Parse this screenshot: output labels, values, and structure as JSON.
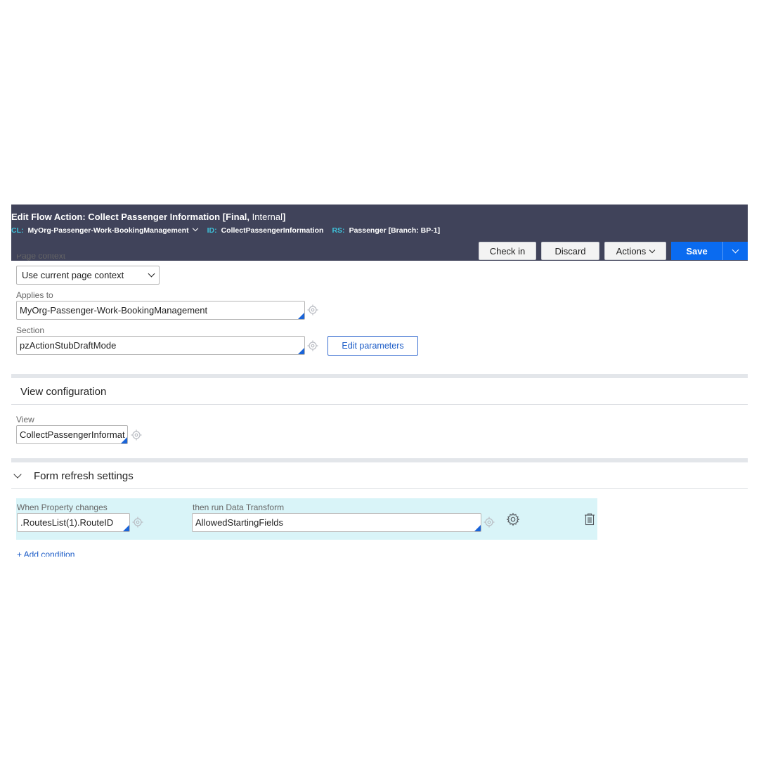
{
  "header": {
    "title_edit": "Edit",
    "title_main": "Flow Action: Collect Passenger Information [",
    "title_final": "Final,",
    "title_internal": " Internal",
    "title_close": "]",
    "cl_key": "CL:",
    "cl_value": "MyOrg-Passenger-Work-BookingManagement",
    "id_key": "ID:",
    "id_value": "CollectPassengerInformation",
    "rs_key": "RS:",
    "rs_value": "Passenger [Branch: BP-1]",
    "buttons": {
      "check_in": "Check in",
      "discard": "Discard",
      "actions": "Actions",
      "save": "Save"
    }
  },
  "form": {
    "page_context_label": "Page context",
    "page_context_value": "Use current page context",
    "applies_to_label": "Applies to",
    "applies_to_value": "MyOrg-Passenger-Work-BookingManagement",
    "section_label": "Section",
    "section_value": "pzActionStubDraftMode",
    "edit_parameters": "Edit parameters"
  },
  "view_configuration": {
    "title": "View configuration",
    "view_label": "View",
    "view_value": "CollectPassengerInformat"
  },
  "form_refresh": {
    "title": "Form refresh settings",
    "when_label": "When Property changes",
    "when_value": ".RoutesList(1).RouteID",
    "then_label": "then run Data Transform",
    "then_value": "AllowedStartingFields",
    "add_condition": "+ Add condition"
  },
  "icons": {
    "target": "crosshair-target-icon",
    "gear": "gear-icon",
    "trash": "trash-icon"
  },
  "colors": {
    "header_bg": "#40435a",
    "header_key": "#3fc1d9",
    "primary": "#0a6bf0",
    "row_highlight": "#d9f4f8"
  }
}
